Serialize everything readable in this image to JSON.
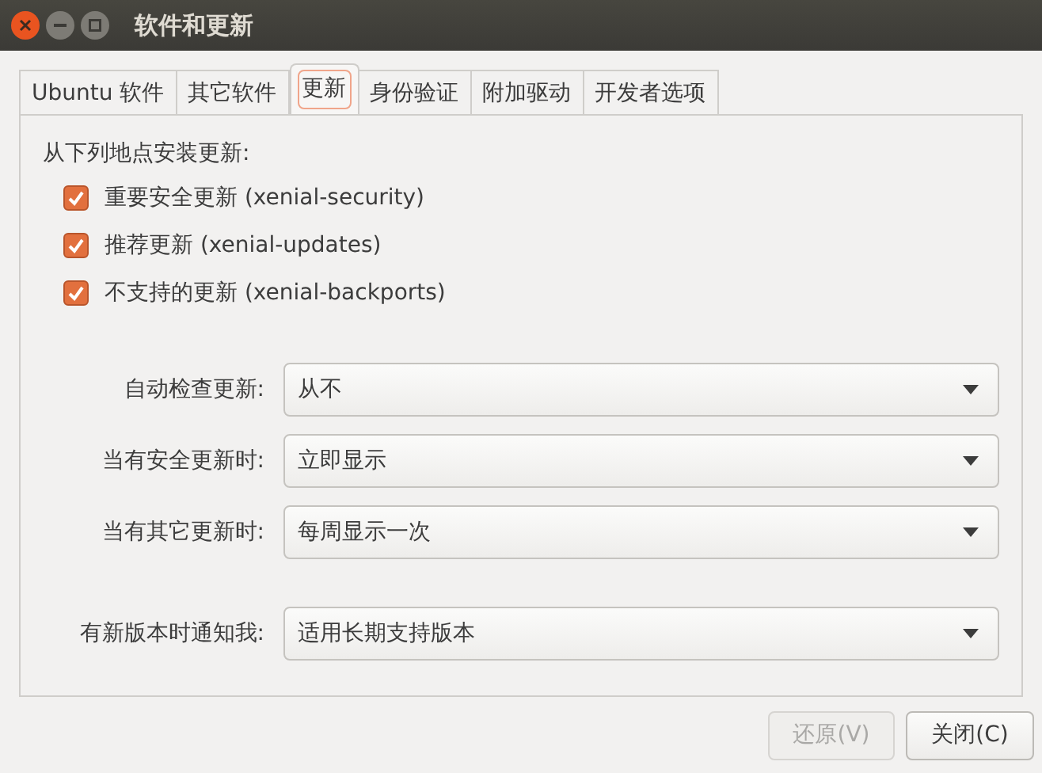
{
  "window": {
    "title": "软件和更新"
  },
  "tabs": [
    {
      "label": "Ubuntu 软件",
      "selected": false
    },
    {
      "label": "其它软件",
      "selected": false
    },
    {
      "label": "更新",
      "selected": true
    },
    {
      "label": "身份验证",
      "selected": false
    },
    {
      "label": "附加驱动",
      "selected": false
    },
    {
      "label": "开发者选项",
      "selected": false
    }
  ],
  "sources": {
    "heading": "从下列地点安装更新:",
    "items": [
      {
        "label": "重要安全更新 (xenial-security)",
        "checked": true
      },
      {
        "label": "推荐更新 (xenial-updates)",
        "checked": true
      },
      {
        "label": "不支持的更新 (xenial-backports)",
        "checked": true
      }
    ]
  },
  "settings": [
    {
      "label": "自动检查更新:",
      "value": "从不"
    },
    {
      "label": "当有安全更新时:",
      "value": "立即显示"
    },
    {
      "label": "当有其它更新时:",
      "value": "每周显示一次"
    },
    {
      "label": "有新版本时通知我:",
      "value": "适用长期支持版本"
    }
  ],
  "buttons": [
    {
      "label": "还原(V)",
      "disabled": true
    },
    {
      "label": "关闭(C)",
      "disabled": false
    }
  ]
}
